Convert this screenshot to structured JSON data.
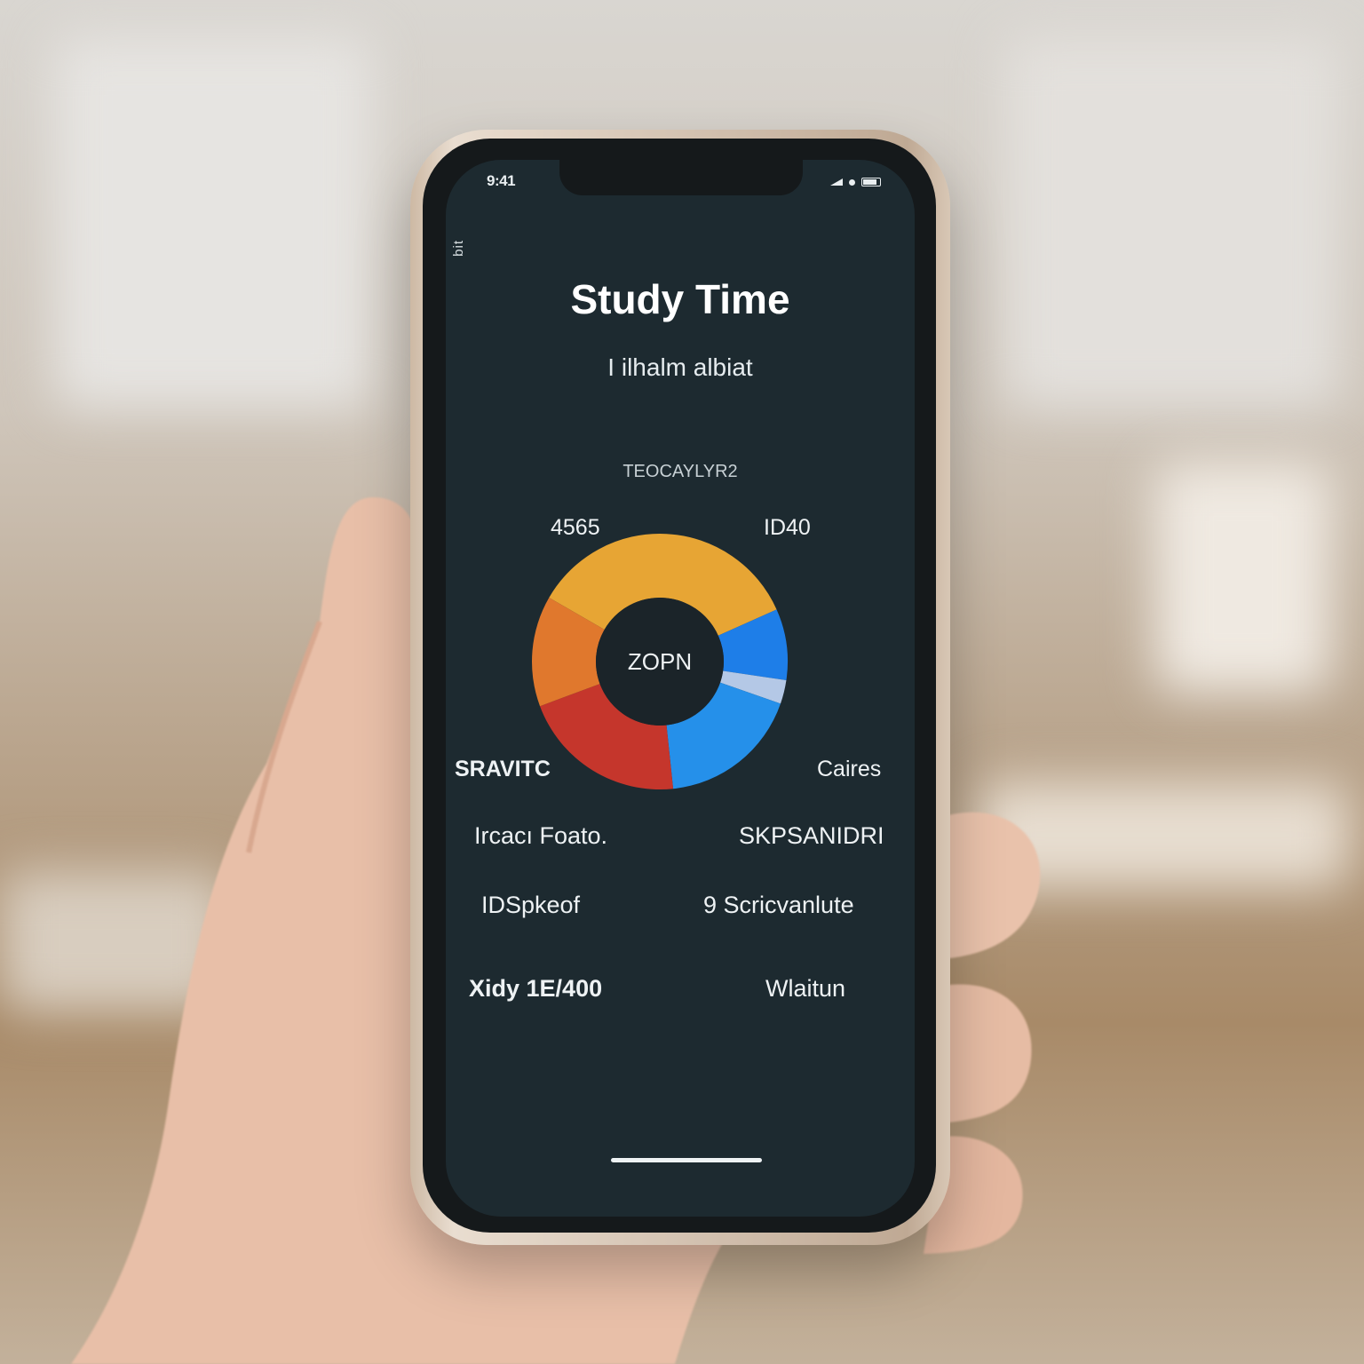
{
  "status_bar": {
    "time": "9:41"
  },
  "side_label": "bit",
  "app": {
    "title": "Study Time",
    "subtitle": "I ilhalm albiat",
    "chart_caption": "TEOCAYLYR2"
  },
  "chart_labels": {
    "top_left": "4565",
    "top_right": "ID40",
    "center": "ZOPN",
    "left": "SRAVITC",
    "right": "Caires"
  },
  "list": [
    {
      "left": "Ircacı Foato.",
      "right": "SKPSANIDRI"
    },
    {
      "left": "IDSpkeof",
      "right": "9 Scricvanlute"
    },
    {
      "left": "Xidy 1E/400",
      "right": "Wlaitun"
    }
  ],
  "chart_data": {
    "type": "pie",
    "categories": [
      "",
      "",
      "",
      "",
      "",
      ""
    ],
    "values": [
      35,
      9,
      3,
      18,
      21,
      14
    ],
    "colors": [
      "#e7a534",
      "#1e7ee8",
      "#b4c8e6",
      "#2590ea",
      "#c5362c",
      "#e0782d"
    ]
  }
}
